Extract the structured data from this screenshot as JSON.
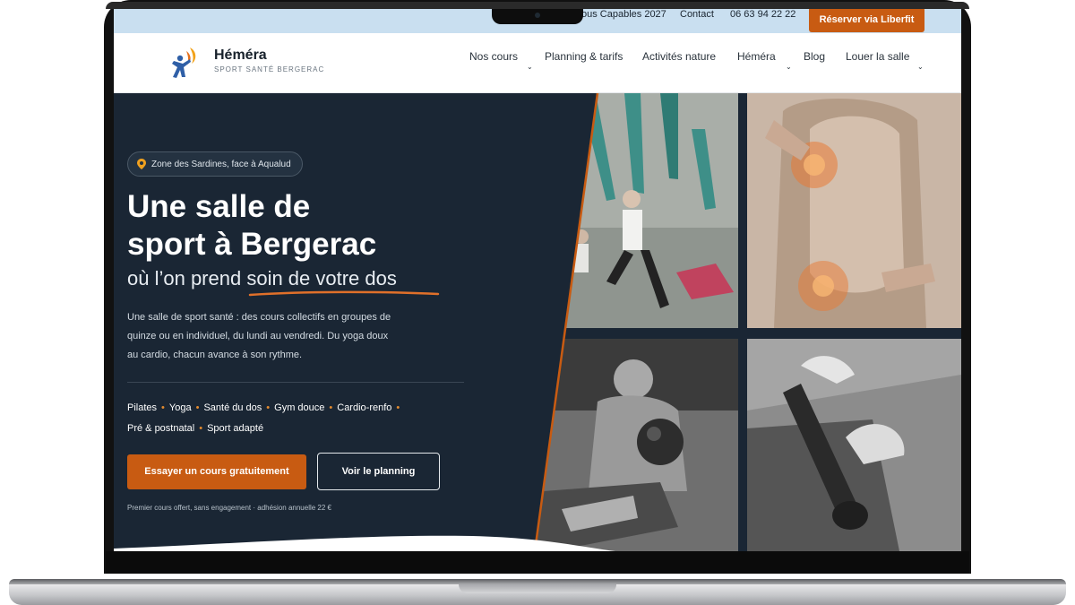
{
  "topbar": {
    "links": [
      "ous Capables 2027",
      "Contact",
      "06 63 94 22 22"
    ],
    "cta": "Réserver via Liberfit"
  },
  "brand": {
    "name": "Héméra",
    "tagline": "SPORT SANTÉ BERGERAC"
  },
  "nav": {
    "items": [
      {
        "label": "Nos cours",
        "dropdown": true
      },
      {
        "label": "Planning & tarifs",
        "dropdown": false
      },
      {
        "label": "Activités nature",
        "dropdown": false
      },
      {
        "label": "Héméra",
        "dropdown": true
      },
      {
        "label": "Blog",
        "dropdown": false
      },
      {
        "label": "Louer la salle",
        "dropdown": true
      }
    ]
  },
  "hero": {
    "location": "Zone des Sardines, face à Aqualud",
    "title_line1": "Une salle de",
    "title_line2": "sport à Bergerac",
    "subtitle_prefix": "où l’on prend ",
    "subtitle_highlight": "soin de votre dos",
    "lead": "Une salle de sport santé : des cours collectifs en groupes de quinze ou en individuel, du lundi au vendredi. Du yoga doux au cardio, chacun avance à son rythme.",
    "tags": [
      "Pilates",
      "Yoga",
      "Santé du dos",
      "Gym douce",
      "Cardio-renfo",
      "Pré & postnatal",
      "Sport adapté"
    ],
    "cta_primary": "Essayer un cours gratuitement",
    "cta_secondary": "Voir le planning",
    "footnote": "Premier cours offert, sans engagement · adhésion annuelle 22 €"
  },
  "colors": {
    "accent": "#c85b12",
    "hero_bg": "#1a2634",
    "topbar_bg": "#c9dff0"
  }
}
